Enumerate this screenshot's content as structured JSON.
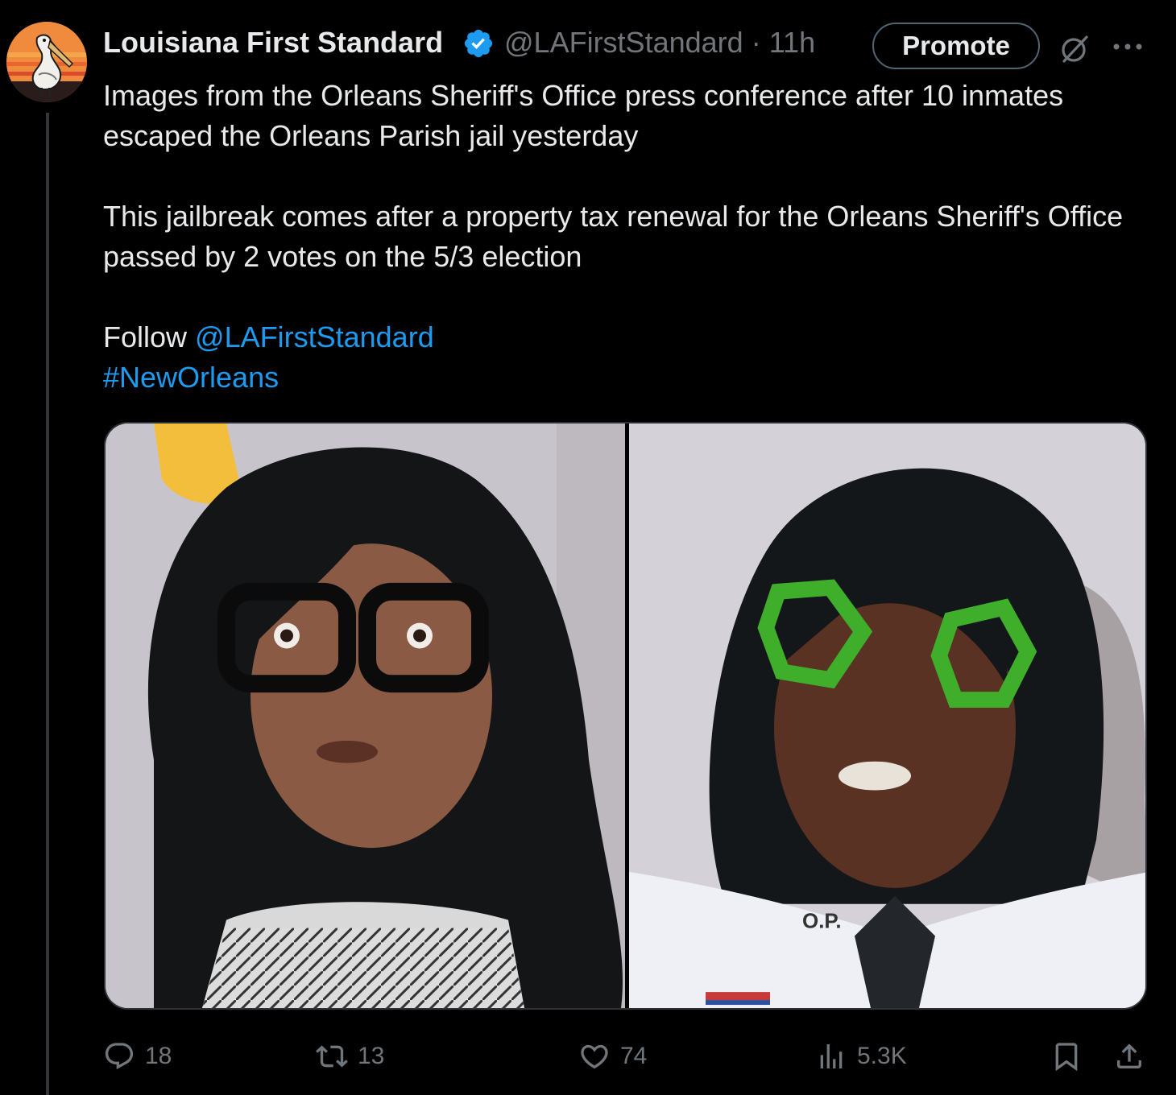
{
  "author": {
    "name": "Louisiana First Standard",
    "handle": "@LAFirstStandard",
    "time": "11h",
    "separator": "·"
  },
  "header": {
    "promote_label": "Promote"
  },
  "tweet": {
    "line1": "Images from the Orleans Sheriff's Office press conference after 10 inmates escaped the Orleans Parish jail yesterday",
    "line2": "This jailbreak comes after a property tax renewal for the Orleans Sheriff's Office passed by 2 votes on the 5/3 election",
    "follow_prefix": "Follow",
    "mention": "@LAFirstStandard",
    "hashtag": "#NewOrleans"
  },
  "media": {
    "right_photo_badge": "O.P."
  },
  "actions": {
    "replies": "18",
    "reposts": "13",
    "likes": "74",
    "views": "5.3K"
  },
  "colors": {
    "background": "#000000",
    "text": "#e7e9ea",
    "muted": "#71767b",
    "link": "#1d9bf0",
    "verified": "#1d9bf0"
  }
}
